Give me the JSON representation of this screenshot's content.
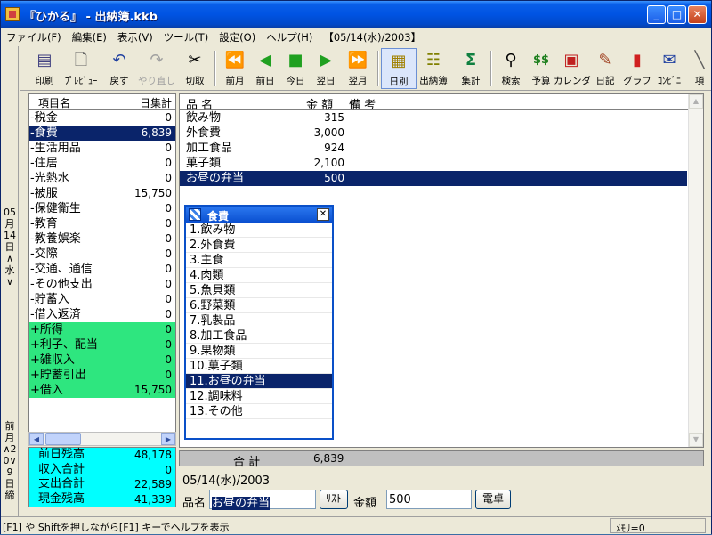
{
  "window": {
    "title": "『ひかる』 - 出納簿.kkb",
    "min": "_",
    "max": "□",
    "close": "✕"
  },
  "menu": [
    "ファイル(F)",
    "編集(E)",
    "表示(V)",
    "ツール(T)",
    "設定(O)",
    "ヘルプ(H)",
    "【05/14(水)/2003】"
  ],
  "datestrip": {
    "top": "05月14日∧水∨",
    "bottom": "前月∧20∨9日締"
  },
  "toolbar": {
    "print": "印刷",
    "preview": "ﾌﾟﾚﾋﾞｭｰ",
    "undo": "戻す",
    "redo": "やり直し",
    "cut": "切取",
    "prev_month": "前月",
    "prev_day": "前日",
    "today": "今日",
    "next_day": "翌日",
    "next_month": "翌月",
    "daily": "日別",
    "ledger": "出納簿",
    "total": "集計",
    "search": "検索",
    "budget": "予算",
    "calendar": "カレンダ",
    "diary": "日記",
    "graph": "グラフ",
    "convenience": "ｺﾝﾋﾞﾆ",
    "more": "項"
  },
  "left_header": {
    "name": "項目名",
    "daily": "日集計"
  },
  "left_items": [
    {
      "name": "-税金",
      "value": "0"
    },
    {
      "name": "-食費",
      "value": "6,839",
      "selected": true
    },
    {
      "name": "-生活用品",
      "value": "0"
    },
    {
      "name": "-住居",
      "value": "0"
    },
    {
      "name": "-光熱水",
      "value": "0"
    },
    {
      "name": "-被服",
      "value": "15,750"
    },
    {
      "name": "-保健衛生",
      "value": "0"
    },
    {
      "name": "-教育",
      "value": "0"
    },
    {
      "name": "-教養娯楽",
      "value": "0"
    },
    {
      "name": "-交際",
      "value": "0"
    },
    {
      "name": "-交通、通信",
      "value": "0"
    },
    {
      "name": "-その他支出",
      "value": "0"
    },
    {
      "name": "-貯蓄入",
      "value": "0"
    },
    {
      "name": "-借入返済",
      "value": "0"
    },
    {
      "name": "+所得",
      "value": "0",
      "income": true
    },
    {
      "name": "+利子、配当",
      "value": "0",
      "income": true
    },
    {
      "name": "+雑収入",
      "value": "0",
      "income": true
    },
    {
      "name": "+貯蓄引出",
      "value": "0",
      "income": true
    },
    {
      "name": "+借入",
      "value": "15,750",
      "income": true
    }
  ],
  "summary": [
    {
      "name": "前日残高",
      "value": "48,178"
    },
    {
      "name": "収入合計",
      "value": "0"
    },
    {
      "name": "支出合計",
      "value": "22,589"
    },
    {
      "name": "現金残高",
      "value": "41,339"
    }
  ],
  "main_header": {
    "name": "品 名",
    "amount": "金 額",
    "note": "備 考"
  },
  "main_items": [
    {
      "name": "飲み物",
      "value": "315"
    },
    {
      "name": "外食費",
      "value": "3,000"
    },
    {
      "name": "加工食品",
      "value": "924"
    },
    {
      "name": "菓子類",
      "value": "2,100"
    },
    {
      "name": "お昼の弁当",
      "value": "500",
      "selected": true
    }
  ],
  "popup": {
    "title": "食費",
    "close": "✕",
    "items": [
      "1.飲み物",
      "2.外食費",
      "3.主食",
      "4.肉類",
      "5.魚貝類",
      "6.野菜類",
      "7.乳製品",
      "8.加工食品",
      "9.果物類",
      "10.菓子類",
      "11.お昼の弁当",
      "12.調味料",
      "13.その他"
    ],
    "selected_index": 10
  },
  "total": {
    "label": "合 計",
    "value": "6,839"
  },
  "current_date": "05/14(水)/2003",
  "input": {
    "name_label": "品名",
    "name_value": "お昼の弁当",
    "list_button": "ﾘｽﾄ",
    "amount_label": "金額",
    "amount_value": "500",
    "calc_button": "電卓"
  },
  "status": {
    "help": "[F1] や Shiftを押しながら[F1] キーでヘルプを表示",
    "memory": "ﾒﾓﾘ=0"
  },
  "colors": {
    "selection": "#0a246a",
    "income_row": "#2ee67f",
    "summary_bg": "#00ffff"
  }
}
